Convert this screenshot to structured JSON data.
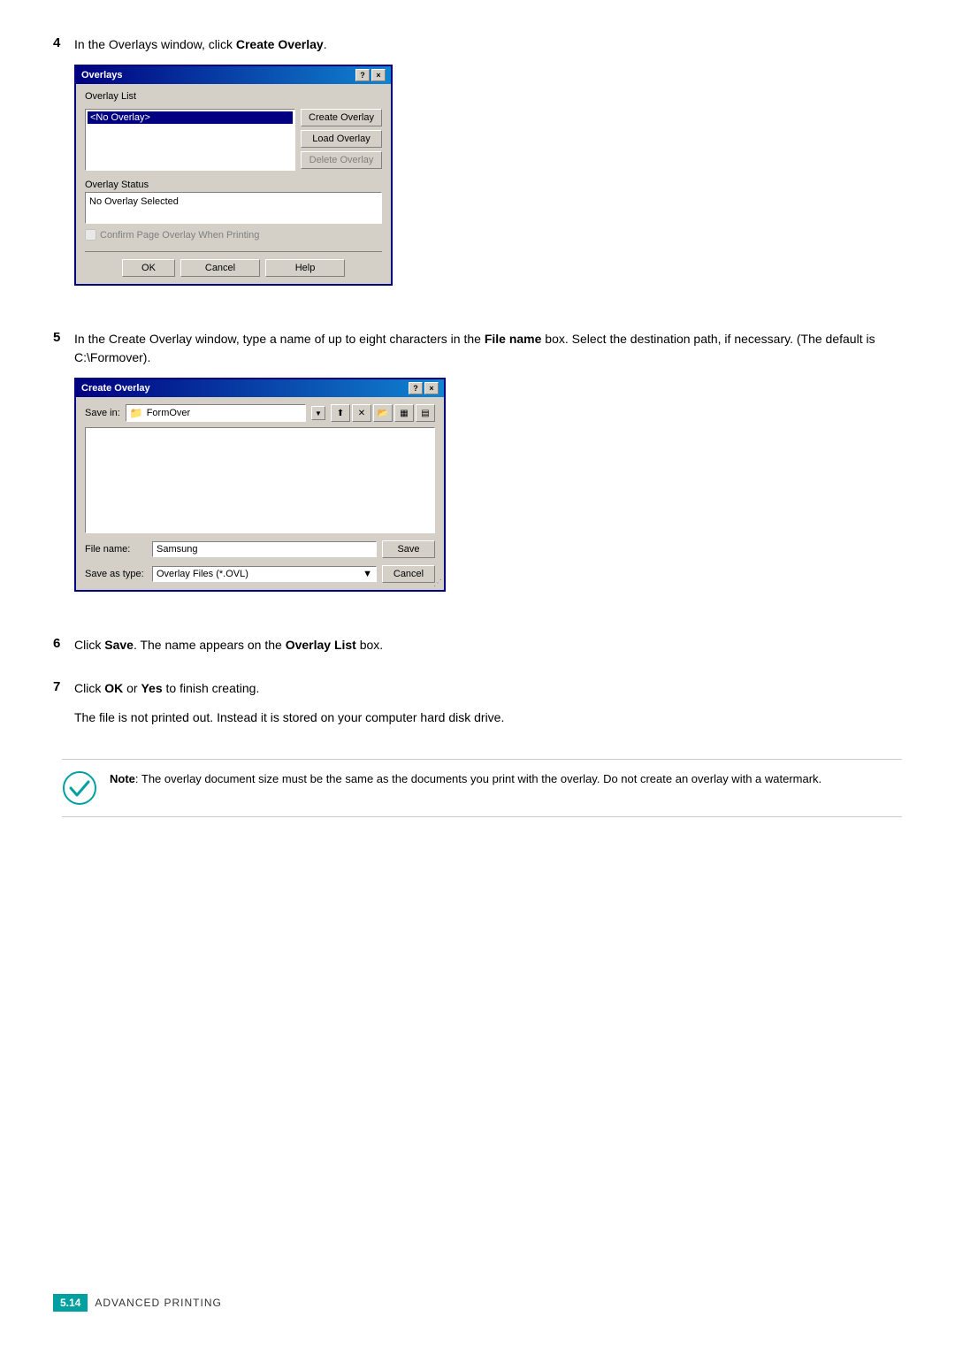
{
  "steps": [
    {
      "number": "4",
      "text_before": "In the Overlays window, click ",
      "text_bold": "Create Overlay",
      "text_after": ".",
      "dialog": {
        "title": "Overlays",
        "titlebar_buttons": [
          "?",
          "×"
        ],
        "overlay_list_label": "Overlay List",
        "list_item": "<No Overlay>",
        "buttons": [
          {
            "label": "Create Overlay",
            "enabled": true
          },
          {
            "label": "Load Overlay",
            "enabled": true
          },
          {
            "label": "Delete Overlay",
            "enabled": false
          }
        ],
        "status_label": "Overlay Status",
        "status_value": "No Overlay Selected",
        "checkbox_label": "Confirm Page Overlay When Printing",
        "bottom_buttons": [
          "OK",
          "Cancel",
          "Help"
        ]
      }
    },
    {
      "number": "5",
      "text_parts": [
        {
          "text": "In the Create Overlay window, type a name of up to eight characters in the ",
          "bold": false
        },
        {
          "text": "File name",
          "bold": true
        },
        {
          "text": " box. Select the destination path, if necessary. (The default is C:\\Formover).",
          "bold": false
        }
      ],
      "dialog": {
        "title": "Create Overlay",
        "titlebar_buttons": [
          "?",
          "×"
        ],
        "save_in_label": "Save in:",
        "save_in_value": "FormOver",
        "toolbar_icons": [
          "⬆",
          "✕",
          "✎",
          "▦",
          "▤"
        ],
        "file_name_label": "File name:",
        "file_name_value": "Samsung",
        "save_button": "Save",
        "save_as_type_label": "Save as type:",
        "save_as_type_value": "Overlay Files (*.OVL)",
        "cancel_button": "Cancel"
      }
    }
  ],
  "step6": {
    "number": "6",
    "text_before": "Click ",
    "text_bold1": "Save",
    "text_middle": ". The name appears on the ",
    "text_bold2": "Overlay List",
    "text_after": " box."
  },
  "step7": {
    "number": "7",
    "text_before": "Click ",
    "text_bold1": "OK",
    "text_middle": " or ",
    "text_bold2": "Yes",
    "text_after": " to finish creating."
  },
  "step7_sub": "The file is not printed out. Instead it is stored on your computer hard disk drive.",
  "note": {
    "label": "Note",
    "text": ": The overlay document size must be the same as the documents you print with the overlay. Do not create an overlay with a watermark."
  },
  "footer": {
    "badge": "5.14",
    "text": "Advanced Printing"
  }
}
